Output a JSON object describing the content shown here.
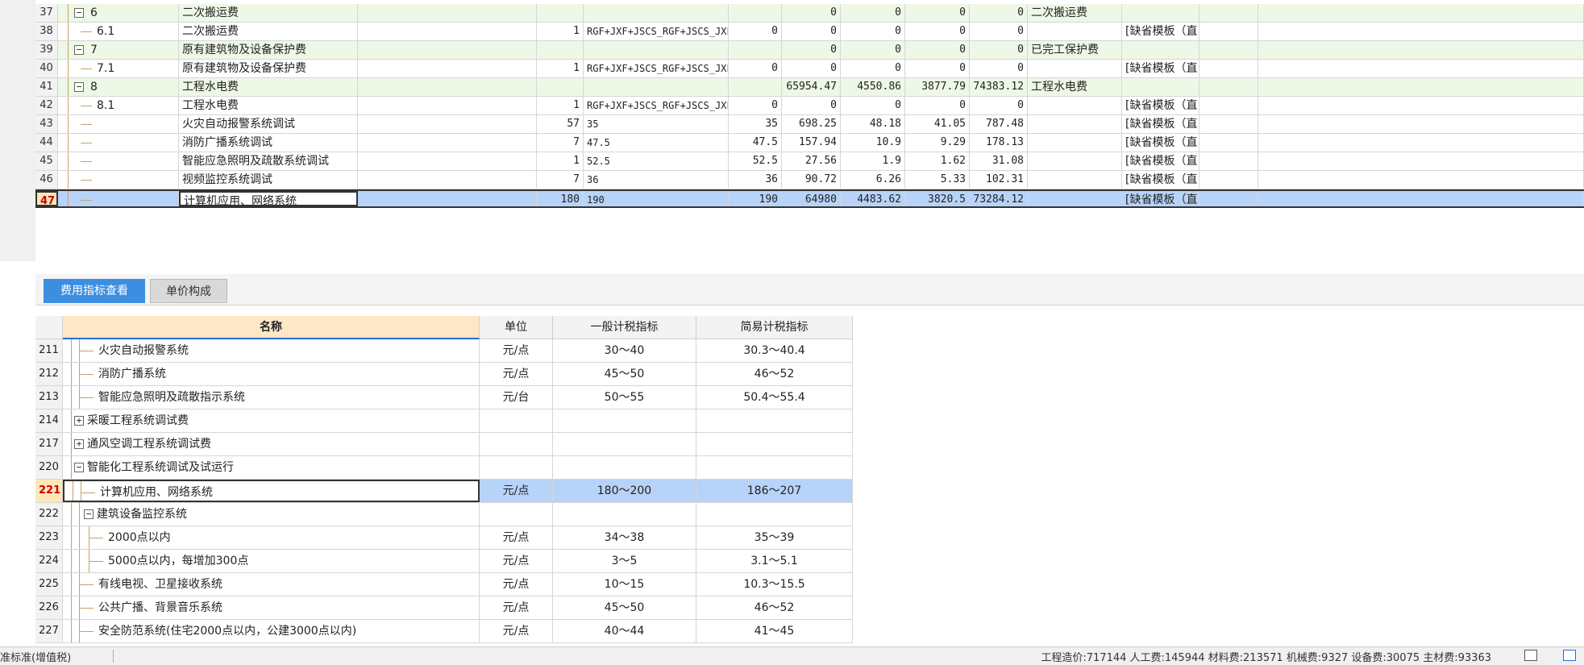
{
  "top_grid": {
    "rows": [
      {
        "no": "37",
        "code": "6",
        "name": "二次搬运费",
        "qty": "",
        "formula": "",
        "price": "",
        "v1": "0",
        "v2": "0",
        "v3": "0",
        "v4": "0",
        "category": "二次搬运费",
        "template": "",
        "group": true,
        "toggle": "−",
        "depth": 0
      },
      {
        "no": "38",
        "code": "6.1",
        "name": "二次搬运费",
        "qty": "1",
        "formula": "RGF+JXF+JSCS_RGF+JSCS_JXF",
        "price": "0",
        "v1": "0",
        "v2": "0",
        "v3": "0",
        "v4": "0",
        "category": "",
        "template": "[缺省模板（直…",
        "group": false,
        "toggle": "",
        "depth": 1
      },
      {
        "no": "39",
        "code": "7",
        "name": "原有建筑物及设备保护费",
        "qty": "",
        "formula": "",
        "price": "",
        "v1": "0",
        "v2": "0",
        "v3": "0",
        "v4": "0",
        "category": "已完工保护费",
        "template": "",
        "group": true,
        "toggle": "−",
        "depth": 0
      },
      {
        "no": "40",
        "code": "7.1",
        "name": "原有建筑物及设备保护费",
        "qty": "1",
        "formula": "RGF+JXF+JSCS_RGF+JSCS_JXF",
        "price": "0",
        "v1": "0",
        "v2": "0",
        "v3": "0",
        "v4": "0",
        "category": "",
        "template": "[缺省模板（直…",
        "group": false,
        "toggle": "",
        "depth": 1
      },
      {
        "no": "41",
        "code": "8",
        "name": "工程水电费",
        "qty": "",
        "formula": "",
        "price": "",
        "v1": "65954.47",
        "v2": "4550.86",
        "v3": "3877.79",
        "v4": "74383.12",
        "category": "工程水电费",
        "template": "",
        "group": true,
        "toggle": "−",
        "depth": 0
      },
      {
        "no": "42",
        "code": "8.1",
        "name": "工程水电费",
        "qty": "1",
        "formula": "RGF+JXF+JSCS_RGF+JSCS_JXF",
        "price": "0",
        "v1": "0",
        "v2": "0",
        "v3": "0",
        "v4": "0",
        "category": "",
        "template": "[缺省模板（直…",
        "group": false,
        "toggle": "",
        "depth": 1
      },
      {
        "no": "43",
        "code": "",
        "name": "火灾自动报警系统调试",
        "qty": "57",
        "formula": "35",
        "price": "35",
        "v1": "698.25",
        "v2": "48.18",
        "v3": "41.05",
        "v4": "787.48",
        "category": "",
        "template": "[缺省模板（直…",
        "group": false,
        "toggle": "",
        "depth": 1
      },
      {
        "no": "44",
        "code": "",
        "name": "消防广播系统调试",
        "qty": "7",
        "formula": "47.5",
        "price": "47.5",
        "v1": "157.94",
        "v2": "10.9",
        "v3": "9.29",
        "v4": "178.13",
        "category": "",
        "template": "[缺省模板（直…",
        "group": false,
        "toggle": "",
        "depth": 1
      },
      {
        "no": "45",
        "code": "",
        "name": "智能应急照明及疏散系统调试",
        "qty": "1",
        "formula": "52.5",
        "price": "52.5",
        "v1": "27.56",
        "v2": "1.9",
        "v3": "1.62",
        "v4": "31.08",
        "category": "",
        "template": "[缺省模板（直…",
        "group": false,
        "toggle": "",
        "depth": 1
      },
      {
        "no": "46",
        "code": "",
        "name": "视频监控系统调试",
        "qty": "7",
        "formula": "36",
        "price": "36",
        "v1": "90.72",
        "v2": "6.26",
        "v3": "5.33",
        "v4": "102.31",
        "category": "",
        "template": "[缺省模板（直…",
        "group": false,
        "toggle": "",
        "depth": 1
      },
      {
        "no": "47",
        "code": "",
        "name": "计算机应用、网络系统",
        "qty": "180",
        "formula": "190",
        "price": "190",
        "v1": "64980",
        "v2": "4483.62",
        "v3": "3820.5",
        "v4": "73284.12",
        "category": "",
        "template": "[缺省模板（直…",
        "group": false,
        "toggle": "",
        "depth": 1,
        "selected": true,
        "editor": "···"
      }
    ]
  },
  "tabs": [
    {
      "label": "费用指标查看",
      "active": true
    },
    {
      "label": "单价构成",
      "active": false
    }
  ],
  "bottom_grid": {
    "headers": {
      "name": "名称",
      "unit": "单位",
      "general": "一般计税指标",
      "simple": "简易计税指标"
    },
    "rows": [
      {
        "no": "211",
        "name": "火灾自动报警系统",
        "unit": "元/点",
        "general": "30～40",
        "simple": "30.3～40.4",
        "toggle": "",
        "level": 2
      },
      {
        "no": "212",
        "name": "消防广播系统",
        "unit": "元/点",
        "general": "45～50",
        "simple": "46～52",
        "toggle": "",
        "level": 2
      },
      {
        "no": "213",
        "name": "智能应急照明及疏散指示系统",
        "unit": "元/台",
        "general": "50～55",
        "simple": "50.4～55.4",
        "toggle": "",
        "level": 2
      },
      {
        "no": "214",
        "name": "采暖工程系统调试费",
        "unit": "",
        "general": "",
        "simple": "",
        "toggle": "+",
        "level": 1
      },
      {
        "no": "217",
        "name": "通风空调工程系统调试费",
        "unit": "",
        "general": "",
        "simple": "",
        "toggle": "+",
        "level": 1
      },
      {
        "no": "220",
        "name": "智能化工程系统调试及试运行",
        "unit": "",
        "general": "",
        "simple": "",
        "toggle": "−",
        "level": 1
      },
      {
        "no": "221",
        "name": "计算机应用、网络系统",
        "unit": "元/点",
        "general": "180～200",
        "simple": "186～207",
        "toggle": "",
        "level": 2,
        "selected": true
      },
      {
        "no": "222",
        "name": "建筑设备监控系统",
        "unit": "",
        "general": "",
        "simple": "",
        "toggle": "−",
        "level": 2
      },
      {
        "no": "223",
        "name": "2000点以内",
        "unit": "元/点",
        "general": "34～38",
        "simple": "35～39",
        "toggle": "",
        "level": 3
      },
      {
        "no": "224",
        "name": "5000点以内，每增加300点",
        "unit": "元/点",
        "general": "3～5",
        "simple": "3.1～5.1",
        "toggle": "",
        "level": 3
      },
      {
        "no": "225",
        "name": "有线电视、卫星接收系统",
        "unit": "元/点",
        "general": "10～15",
        "simple": "10.3～15.5",
        "toggle": "",
        "level": 2
      },
      {
        "no": "226",
        "name": "公共广播、背景音乐系统",
        "unit": "元/点",
        "general": "45～50",
        "simple": "46～52",
        "toggle": "",
        "level": 2
      },
      {
        "no": "227",
        "name": "安全防范系统(住宅2000点以内，公建3000点以内)",
        "unit": "元/点",
        "general": "40～44",
        "simple": "41～45",
        "toggle": "",
        "level": 2
      }
    ]
  },
  "status_bar": {
    "left_text": "准标准(增值税)",
    "right_text": "工程造价:717144  人工费:145944  材料费:213571  机械费:9327  设备费:30075  主材费:93363"
  },
  "colors": {
    "accent": "#3d8ee0",
    "selection": "#b8d3f8",
    "group_row": "#eef8e6",
    "header_name": "#fde7c6"
  }
}
